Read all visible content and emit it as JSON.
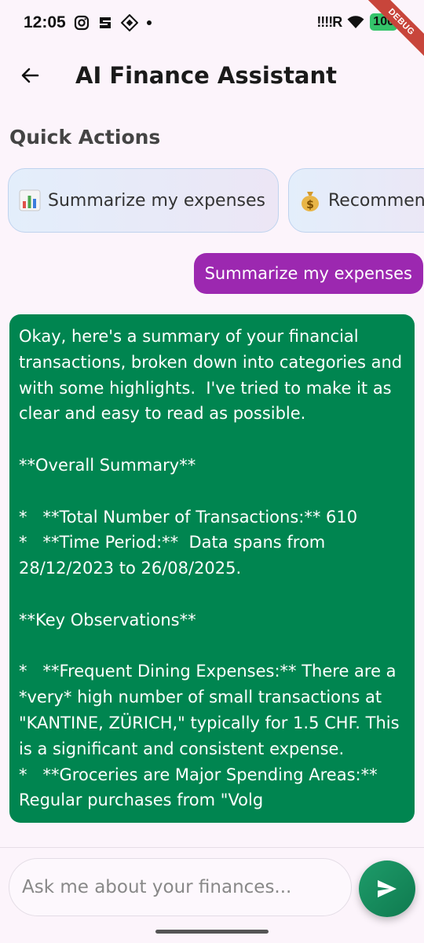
{
  "status_bar": {
    "time": "12:05",
    "signal": "!!!!R",
    "battery": "100",
    "debug_label": "DEBUG"
  },
  "app_bar": {
    "title": "AI Finance Assistant"
  },
  "quick_actions": {
    "title": "Quick Actions",
    "items": [
      {
        "icon": "bar-chart-emoji",
        "label": "Summarize my expenses"
      },
      {
        "icon": "money-bag-emoji",
        "label": "Recommen"
      }
    ]
  },
  "chat": {
    "user_message": "Summarize my expenses",
    "ai_message": "Okay, here's a summary of your financial transactions, broken down into categories and with some highlights.  I've tried to make it as clear and easy to read as possible.\n\n**Overall Summary**\n\n*   **Total Number of Transactions:** 610\n*   **Time Period:**  Data spans from 28/12/2023 to 26/08/2025.\n\n**Key Observations**\n\n*   **Frequent Dining Expenses:** There are a *very* high number of small transactions at \"KANTINE, ZÜRICH,\" typically for 1.5 CHF. This is a significant and consistent expense.\n*   **Groceries are Major Spending Areas:** Regular purchases from \"Volg"
  },
  "input": {
    "placeholder": "Ask me about your finances..."
  },
  "colors": {
    "user_bubble": "#9c28b0",
    "ai_bubble": "#008550",
    "send_button": "#15875a"
  }
}
